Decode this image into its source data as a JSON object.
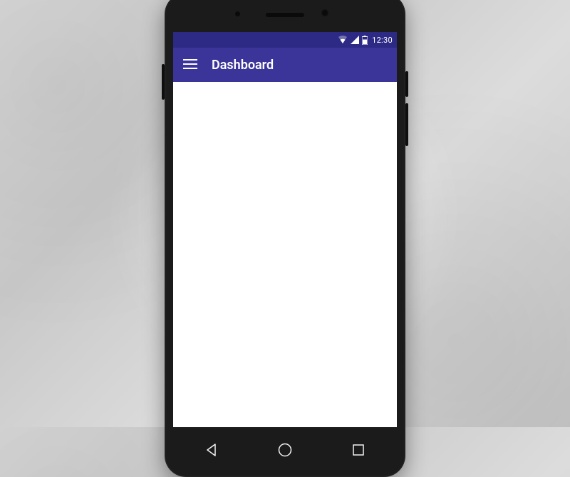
{
  "statusbar": {
    "time": "12:30"
  },
  "appbar": {
    "title": "Dashboard"
  }
}
